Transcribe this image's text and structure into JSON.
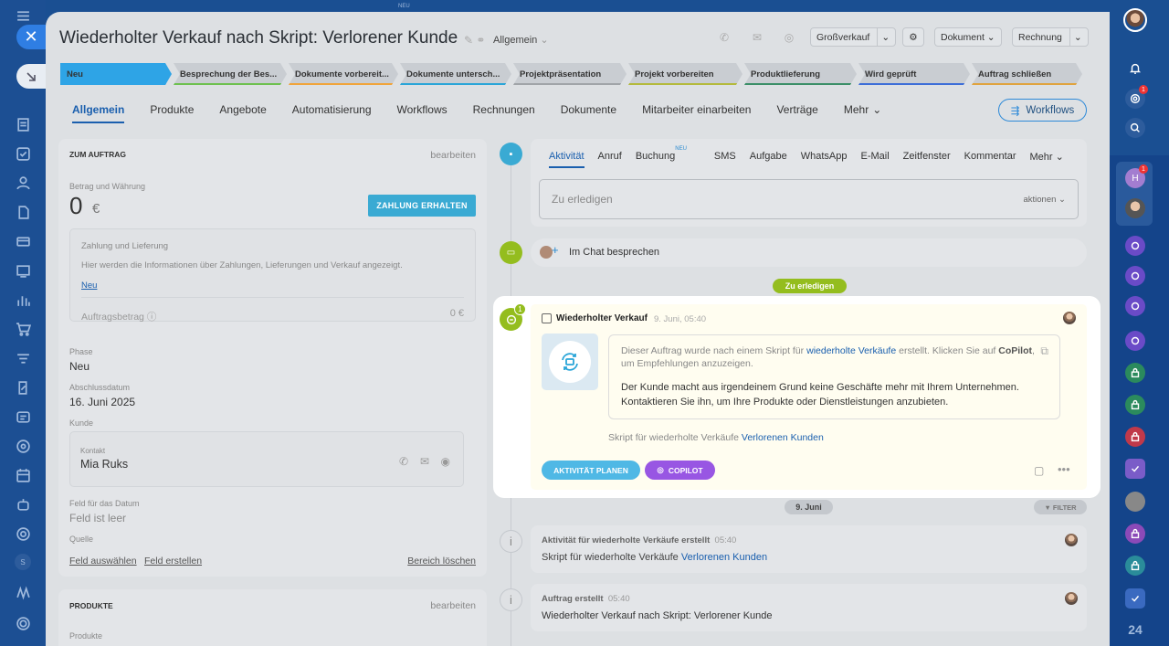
{
  "window": {
    "title": "Wiederholter Verkauf nach Skript: Verlorener Kunde",
    "category": "Allgemein"
  },
  "header": {
    "pipeline": "Großverkauf",
    "document": "Dokument",
    "invoice": "Rechnung",
    "topbar_badge": "NEU"
  },
  "stages": [
    {
      "label": "Neu",
      "color": "#2ea4e6",
      "active": true
    },
    {
      "label": "Besprechung der Bes...",
      "color": "#6ec14f"
    },
    {
      "label": "Dokumente vorbereit...",
      "color": "#f0a43a"
    },
    {
      "label": "Dokumente untersch...",
      "color": "#2aa5d8"
    },
    {
      "label": "Projektpräsentation",
      "color": "#a0a4a8"
    },
    {
      "label": "Projekt vorbereiten",
      "color": "#b4ba3c"
    },
    {
      "label": "Produktlieferung",
      "color": "#3b8f68"
    },
    {
      "label": "Wird geprüft",
      "color": "#3d6ed8"
    },
    {
      "label": "Auftrag schließen",
      "color": "#e0a33e"
    }
  ],
  "tabs": [
    "Allgemein",
    "Produkte",
    "Angebote",
    "Automatisierung",
    "Workflows",
    "Rechnungen",
    "Dokumente",
    "Mitarbeiter einarbeiten",
    "Verträge",
    "Mehr"
  ],
  "workflows_button": "Workflows",
  "order": {
    "section": "ZUM AUFTRAG",
    "edit": "bearbeiten",
    "amount_label": "Betrag und Währung",
    "amount": "0",
    "currency": "€",
    "pay_button": "ZAHLUNG ERHALTEN",
    "payment_title": "Zahlung und Lieferung",
    "payment_text": "Hier werden die Informationen über Zahlungen, Lieferungen und Verkauf angezeigt.",
    "payment_new": "Neu",
    "order_amount_label": "Auftragsbetrag",
    "order_amount": "0 €",
    "phase_label": "Phase",
    "phase": "Neu",
    "close_label": "Abschlussdatum",
    "close_date": "16. Juni 2025",
    "customer_label": "Kunde",
    "contact_label": "Kontakt",
    "contact_name": "Mia Ruks",
    "datefield_label": "Feld für das Datum",
    "datefield_value": "Feld ist leer",
    "source_label": "Quelle",
    "select_field": "Feld auswählen",
    "create_field": "Feld erstellen",
    "clear_section": "Bereich löschen"
  },
  "products": {
    "section": "PRODUKTE",
    "edit": "bearbeiten",
    "label": "Produkte"
  },
  "activity": {
    "tabs": [
      "Aktivität",
      "Anruf",
      "Buchung",
      "SMS",
      "Aufgabe",
      "WhatsApp",
      "E-Mail",
      "Zeitfenster",
      "Kommentar",
      "Mehr"
    ],
    "new_badge": "NEU",
    "todo_placeholder": "Zu erledigen",
    "todo_actions": "aktionen",
    "chat": "Im Chat besprechen",
    "todo_pill": "Zu erledigen"
  },
  "highlight": {
    "badge": "1",
    "title": "Wiederholter Verkauf",
    "time": "9. Juni, 05:40",
    "text1_a": "Dieser Auftrag wurde nach einem Skript für ",
    "text1_link": "wiederholte Verkäufe",
    "text1_b": " erstellt. Klicken Sie auf ",
    "text1_bold": "CoPilot",
    "text1_c": ",",
    "text2": "um Empfehlungen anzuzeigen.",
    "text3": "Der Kunde macht aus irgendeinem Grund keine Geschäfte mehr mit Ihrem Unternehmen.",
    "text4": "Kontaktieren Sie ihn, um Ihre Produkte oder Dienstleistungen anzubieten.",
    "script_label": "Skript für wiederholte Verkäufe",
    "script_link": "Verlorenen Kunden",
    "plan_button": "AKTIVITÄT PLANEN",
    "copilot_button": "COPILOT"
  },
  "history": {
    "date": "9. Juni",
    "filter": "FILTER",
    "item1_title": "Aktivität für wiederholte Verkäufe erstellt",
    "item1_time": "05:40",
    "item1_text": "Skript für wiederholte Verkäufe",
    "item1_link": "Verlorenen Kunden",
    "item2_title": "Auftrag erstellt",
    "item2_time": "05:40",
    "item2_text": "Wiederholter Verkauf nach Skript: Verlorener Kunde"
  },
  "right_sidebar": {
    "badge1": "1",
    "badge2": "1",
    "avatar_letter": "H",
    "counter": "24"
  },
  "left_sidebar": {
    "letter": "S"
  }
}
